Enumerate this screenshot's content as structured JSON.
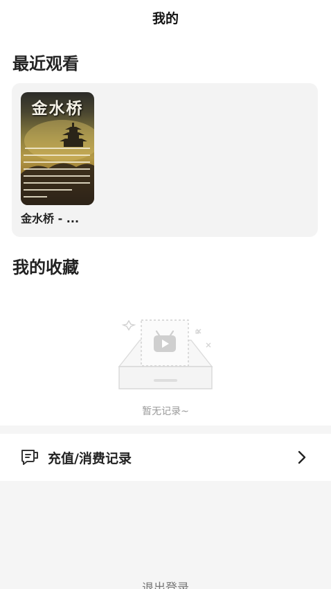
{
  "header": {
    "title": "我的"
  },
  "recent": {
    "section_title": "最近观看",
    "items": [
      {
        "cover_title": "金水桥",
        "name": "金水桥 - ..."
      }
    ]
  },
  "favorites": {
    "section_title": "我的收藏",
    "empty_text": "暂无记录~"
  },
  "menu": {
    "recharge": {
      "label": "充值/消费记录",
      "icon": "receipt-chat-icon"
    }
  },
  "footer": {
    "logout_label": "退出登录"
  },
  "colors": {
    "card_bg": "#f3f3f3",
    "band_bg": "#f5f5f5",
    "muted_text": "#9a9a9a"
  }
}
